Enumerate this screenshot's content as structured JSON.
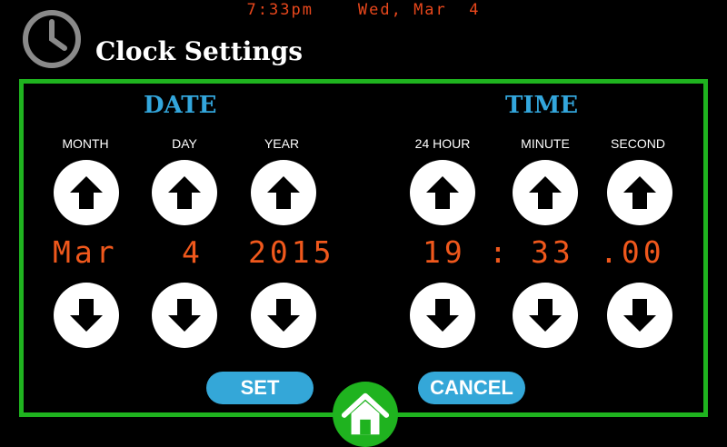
{
  "status_bar": {
    "time": "7:33pm",
    "date": "Wed, Mar  4"
  },
  "header": {
    "title": "Clock Settings",
    "icon": "clock-icon"
  },
  "date_section": {
    "heading": "DATE",
    "columns": [
      {
        "label": "MONTH",
        "value": "Mar"
      },
      {
        "label": "DAY",
        "value": "4"
      },
      {
        "label": "YEAR",
        "value": "2015"
      }
    ]
  },
  "time_section": {
    "heading": "TIME",
    "columns": [
      {
        "label": "24 HOUR",
        "value": "19"
      },
      {
        "label": "MINUTE",
        "value": "33"
      },
      {
        "label": "SECOND",
        "value": ".00"
      }
    ],
    "separator": ":"
  },
  "buttons": {
    "set": "SET",
    "cancel": "CANCEL"
  },
  "colors": {
    "accent_green": "#1fb31f",
    "accent_blue": "#34a7d8",
    "value_orange": "#f0581c"
  }
}
